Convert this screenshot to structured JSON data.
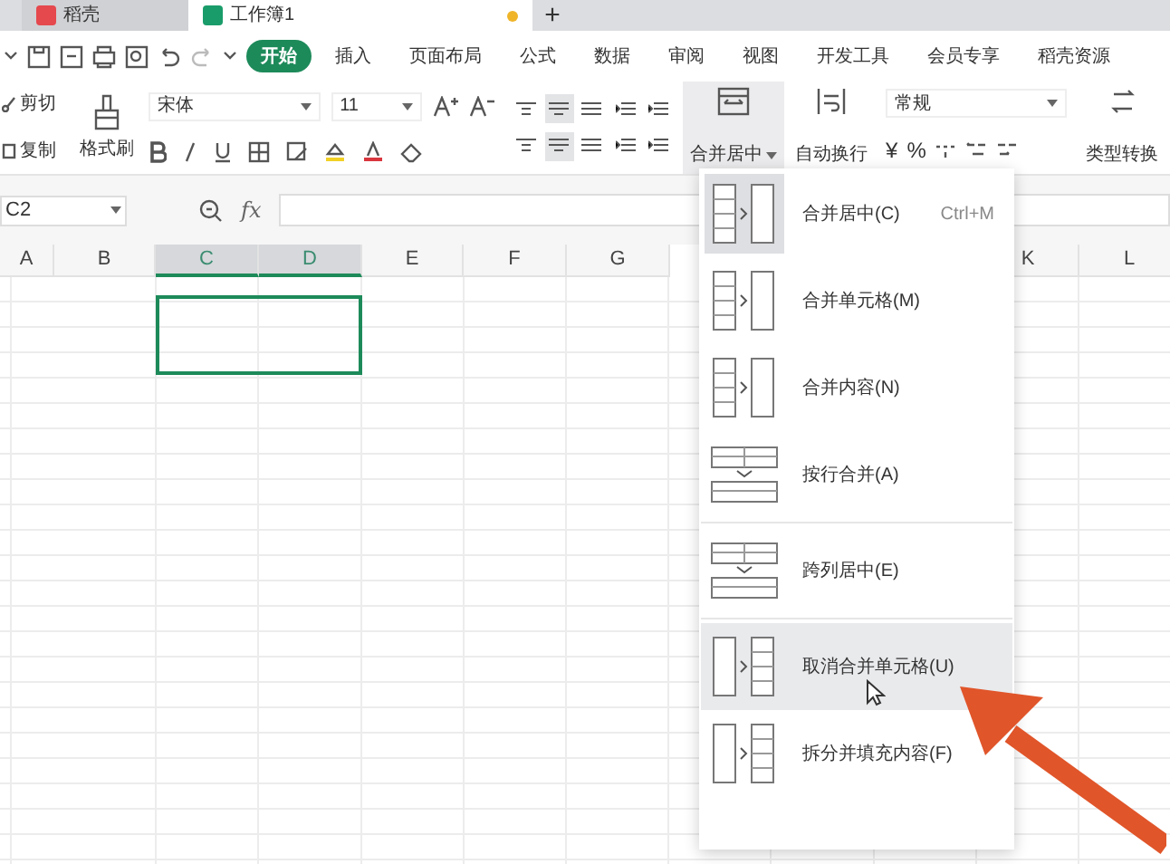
{
  "window_tabs": [
    {
      "label": "稻壳",
      "selected": false,
      "kind": "docer"
    },
    {
      "label": "工作簿1",
      "selected": true,
      "kind": "sheet",
      "unsaved": true
    }
  ],
  "new_tab": "+",
  "ribbon_tabs": [
    {
      "label": "开始",
      "selected": true
    },
    {
      "label": "插入",
      "selected": false
    },
    {
      "label": "页面布局",
      "selected": false
    },
    {
      "label": "公式",
      "selected": false
    },
    {
      "label": "数据",
      "selected": false
    },
    {
      "label": "审阅",
      "selected": false
    },
    {
      "label": "视图",
      "selected": false
    },
    {
      "label": "开发工具",
      "selected": false
    },
    {
      "label": "会员专享",
      "selected": false
    },
    {
      "label": "稻壳资源",
      "selected": false
    }
  ],
  "clipboard": {
    "cut": "剪切",
    "copy": "复制",
    "format_painter": "格式刷"
  },
  "font": {
    "name": "宋体",
    "size": "11"
  },
  "merge_button": {
    "label": "合并居中",
    "pressed": true
  },
  "wrap_button": {
    "label": "自动换行"
  },
  "number": {
    "format": "常规",
    "currency": "¥",
    "percent": "%",
    "convert": "类型转换"
  },
  "formula_bar": {
    "name_box": "C2",
    "fx": "fx"
  },
  "columns": [
    {
      "label": "A",
      "selected": false
    },
    {
      "label": "B",
      "selected": false
    },
    {
      "label": "C",
      "selected": true
    },
    {
      "label": "D",
      "selected": true
    },
    {
      "label": "E",
      "selected": false
    },
    {
      "label": "F",
      "selected": false
    },
    {
      "label": "G",
      "selected": false
    },
    {
      "label": "K",
      "selected": false
    },
    {
      "label": "L",
      "selected": false
    }
  ],
  "merge_menu": [
    {
      "label": "合并居中(C)",
      "shortcut": "Ctrl+M",
      "kind": "stack",
      "current": true,
      "highlighted": false,
      "separator_before": false
    },
    {
      "label": "合并单元格(M)",
      "kind": "stack",
      "current": false,
      "highlighted": false,
      "separator_before": false
    },
    {
      "label": "合并内容(N)",
      "kind": "stack",
      "current": false,
      "highlighted": false,
      "separator_before": false
    },
    {
      "label": "按行合并(A)",
      "kind": "rows",
      "current": false,
      "highlighted": false,
      "separator_before": false
    },
    {
      "label": "跨列居中(E)",
      "kind": "rows",
      "current": false,
      "highlighted": false,
      "separator_before": true
    },
    {
      "label": "取消合并单元格(U)",
      "kind": "split",
      "current": false,
      "highlighted": true,
      "separator_before": true
    },
    {
      "label": "拆分并填充内容(F)",
      "kind": "split",
      "current": false,
      "highlighted": false,
      "separator_before": false
    }
  ]
}
